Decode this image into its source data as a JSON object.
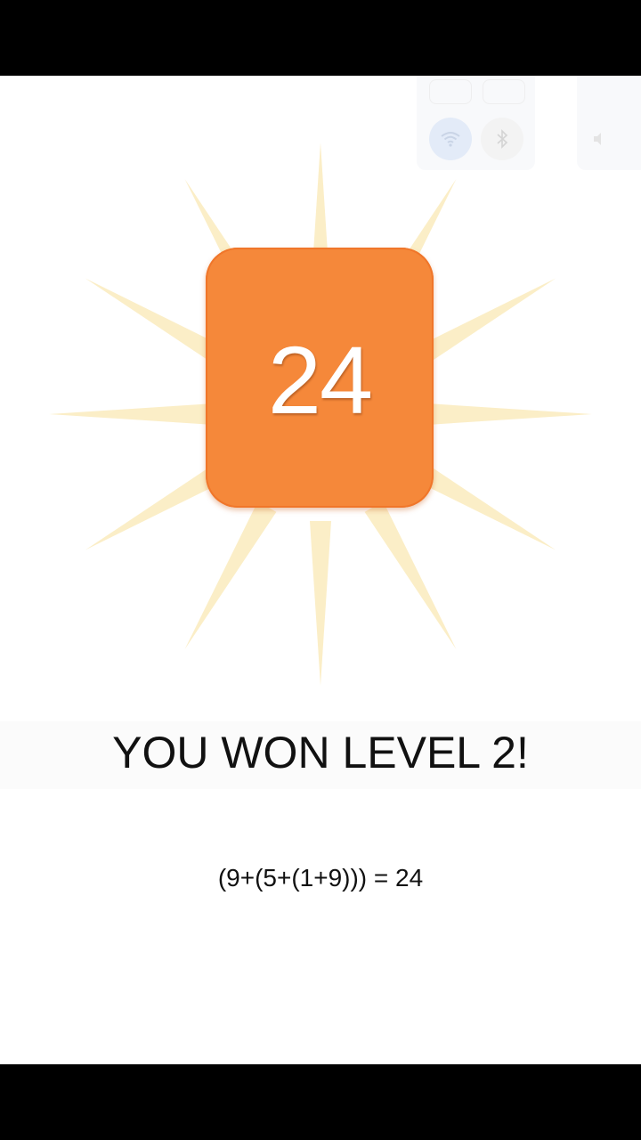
{
  "game": {
    "tile_value": "24",
    "win_message": "YOU WON LEVEL 2!",
    "solution": "(9+(5+(1+9))) = 24"
  },
  "colors": {
    "tile": "#f5883a",
    "tile_border": "#f0762a",
    "ray": "#fbeec7",
    "background": "#ffffff",
    "text": "#111111"
  },
  "overlay": {
    "wifi_icon": "wifi-icon",
    "bluetooth_icon": "bluetooth-icon",
    "sound_icon": "sound-icon"
  }
}
